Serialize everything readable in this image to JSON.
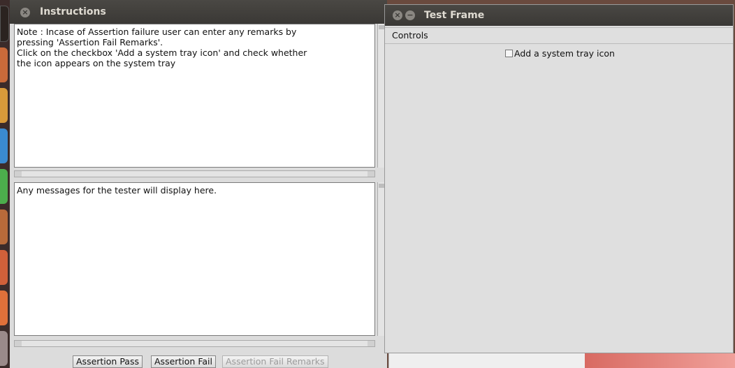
{
  "instructions_window": {
    "title": "Instructions",
    "instructions_text": "Note : Incase of Assertion failure user can enter any remarks by\npressing 'Assertion Fail Remarks'.\nClick on the checkbox 'Add a system tray icon' and check whether\nthe icon appears on the system tray",
    "messages_text": "Any messages for the tester will display here.",
    "buttons": {
      "pass": "Assertion Pass",
      "fail": "Assertion Fail",
      "fail_remarks": "Assertion Fail Remarks"
    }
  },
  "test_frame": {
    "title": "Test Frame",
    "panel_label": "Controls",
    "checkbox_label": "Add a system tray icon",
    "checkbox_checked": false
  },
  "launcher": {
    "icons": [
      "app-icon",
      "app-icon",
      "app-icon",
      "app-icon",
      "app-icon",
      "app-icon",
      "app-icon",
      "app-icon",
      "app-icon"
    ]
  },
  "colors": {
    "titlebar": "#3a3835",
    "window_bg": "#dcdcdc",
    "wallpaper_accent": "#d86a62"
  }
}
